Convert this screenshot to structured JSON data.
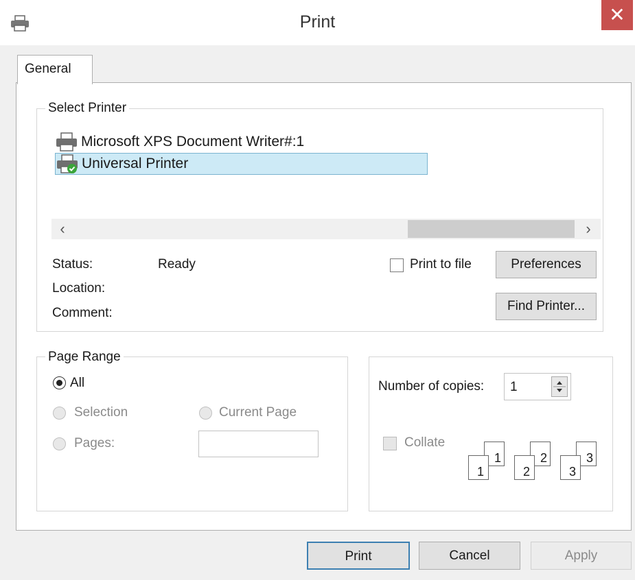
{
  "window": {
    "title": "Print",
    "close_glyph": "✕"
  },
  "tabs": [
    {
      "label": "General"
    }
  ],
  "select_printer": {
    "legend": "Select Printer",
    "printers": [
      {
        "name": "Microsoft XPS Document Writer#:1",
        "icon": "printer-icon",
        "selected": false
      },
      {
        "name": "Universal Printer",
        "icon": "default-printer-icon",
        "selected": true
      }
    ],
    "status_label": "Status:",
    "status_value": "Ready",
    "location_label": "Location:",
    "comment_label": "Comment:",
    "print_to_file_label": "Print to file",
    "print_to_file_checked": false,
    "preferences_label": "Preferences",
    "find_printer_label": "Find Printer..."
  },
  "page_range": {
    "legend": "Page Range",
    "all_label": "All",
    "selection_label": "Selection",
    "current_page_label": "Current Page",
    "pages_label": "Pages:",
    "pages_value": ""
  },
  "copies": {
    "label": "Number of copies:",
    "value": "1",
    "collate_label": "Collate",
    "collate_checked": false,
    "collate_pages": [
      "1",
      "1",
      "2",
      "2",
      "3",
      "3"
    ]
  },
  "buttons": {
    "print": "Print",
    "cancel": "Cancel",
    "apply": "Apply"
  },
  "colors": {
    "close": "#c7504e",
    "selection": "#cdeaf6",
    "selection_border": "#7ab4d0",
    "default_print_border": "#3c7fb1"
  }
}
